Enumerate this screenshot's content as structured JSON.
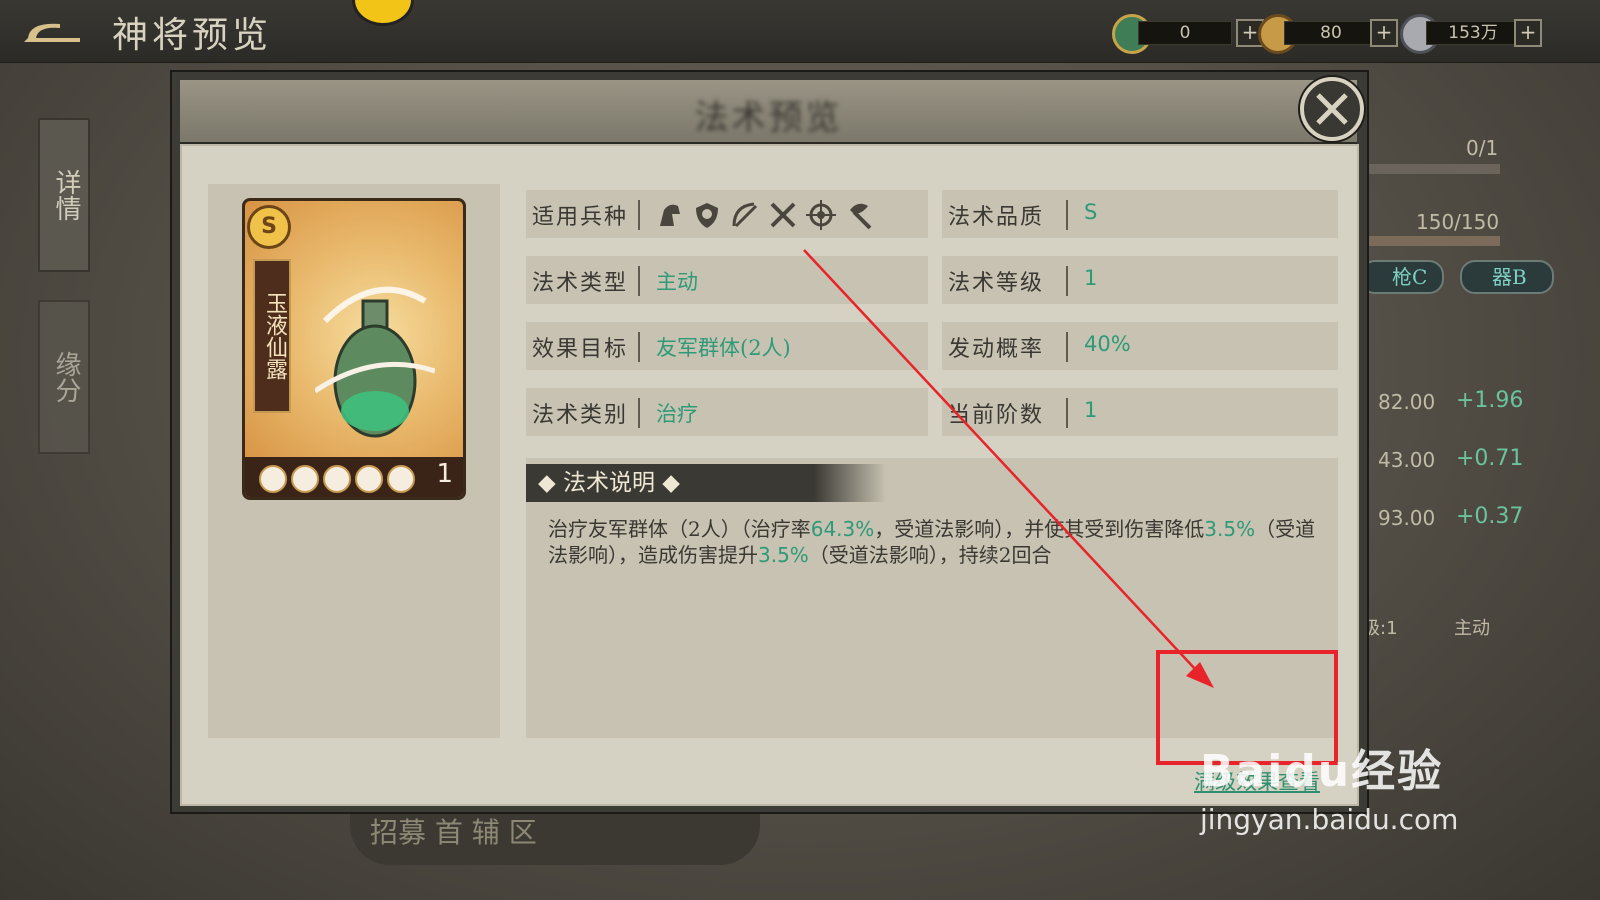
{
  "header": {
    "title": "神将预览",
    "resources": [
      {
        "icon": "jade-coin-icon",
        "value": "0"
      },
      {
        "icon": "copper-coin-icon",
        "value": "80"
      },
      {
        "icon": "silver-ingot-icon",
        "value": "153万"
      }
    ],
    "plus_label": "+"
  },
  "side_tabs": [
    {
      "label": "详情"
    },
    {
      "label": "缘分"
    }
  ],
  "right_panel": {
    "progress1": "0/1",
    "progress2": "150/150",
    "chip1": "枪C",
    "chip2": "器B",
    "stats": [
      {
        "value": "82.00",
        "delta": "+1.96"
      },
      {
        "value": "43.00",
        "delta": "+0.71"
      },
      {
        "value": "93.00",
        "delta": "+0.37"
      }
    ],
    "level_text": "级:1",
    "mode_text": "主动"
  },
  "modal": {
    "title": "法术预览",
    "card": {
      "grade": "S",
      "name": "玉液仙露",
      "level": "1",
      "stars": 5
    },
    "fields_left": [
      {
        "label": "适用兵种",
        "value": ""
      },
      {
        "label": "法术类型",
        "value": "主动"
      },
      {
        "label": "效果目标",
        "value": "友军群体(2人)"
      },
      {
        "label": "法术类别",
        "value": "治疗"
      }
    ],
    "fields_right": [
      {
        "label": "法术品质",
        "value": "S"
      },
      {
        "label": "法术等级",
        "value": "1"
      },
      {
        "label": "发动概率",
        "value": "40%"
      },
      {
        "label": "当前阶数",
        "value": "1"
      }
    ],
    "troop_icons": [
      "cavalry-icon",
      "shield-icon",
      "archer-icon",
      "swords-icon",
      "crosshair-icon",
      "axe-icon"
    ],
    "desc_heading": "◆ 法术说明 ◆",
    "desc": {
      "p1": "治疗友军群体（2人）（治疗率",
      "g1": "64.3%",
      "p2": "，受道法影响），并使其受到伤害降低",
      "g2": "3.5%",
      "p3": "（受道法影响），造成伤害提升",
      "g3": "3.5%",
      "p4": "（受道法影响），持续2回合"
    },
    "max_link": "满级效果查看"
  },
  "bottom_stub": "招募  首 辅 区",
  "watermark": {
    "logo": "Baidu经验",
    "url": "jingyan.baidu.com"
  },
  "colors": {
    "accent_green": "#2f9a78",
    "highlight_red": "#e8232a"
  }
}
